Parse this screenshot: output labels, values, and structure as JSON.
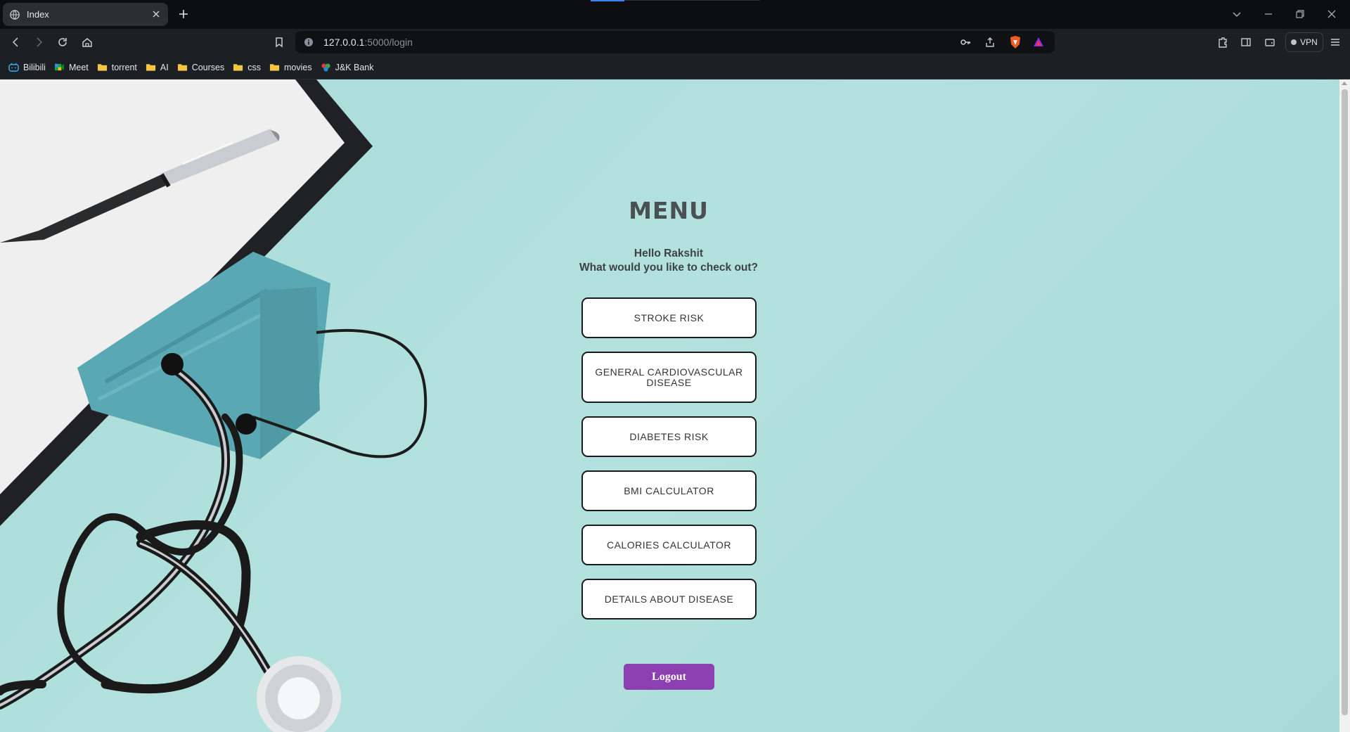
{
  "browser": {
    "tab_title": "Index",
    "url_host": "127.0.0.1",
    "url_path": ":5000/login",
    "vpn_label": "VPN",
    "bookmarks": [
      {
        "label": "Bilibili",
        "icon": "bilibili-icon"
      },
      {
        "label": "Meet",
        "icon": "meet-icon"
      },
      {
        "label": "torrent",
        "icon": "folder-icon"
      },
      {
        "label": "AI",
        "icon": "folder-icon"
      },
      {
        "label": "Courses",
        "icon": "folder-icon"
      },
      {
        "label": "css",
        "icon": "folder-icon"
      },
      {
        "label": "movies",
        "icon": "folder-icon"
      },
      {
        "label": "J&K Bank",
        "icon": "bank-icon"
      }
    ]
  },
  "page": {
    "title": "MENU",
    "greeting_line1": "Hello Rakshit",
    "greeting_line2": "What would you like to check out?",
    "buttons": [
      {
        "label": "STROKE RISK"
      },
      {
        "label": "GENERAL CARDIOVASCULAR DISEASE"
      },
      {
        "label": "DIABETES RISK"
      },
      {
        "label": "BMI CALCULATOR"
      },
      {
        "label": "CALORIES CALCULATOR"
      },
      {
        "label": "DETAILS ABOUT DISEASE"
      }
    ],
    "logout_label": "Logout"
  },
  "colors": {
    "background": "#b0dfdb",
    "logout_button": "#8b3fb0",
    "title_text": "#4a4f52"
  }
}
